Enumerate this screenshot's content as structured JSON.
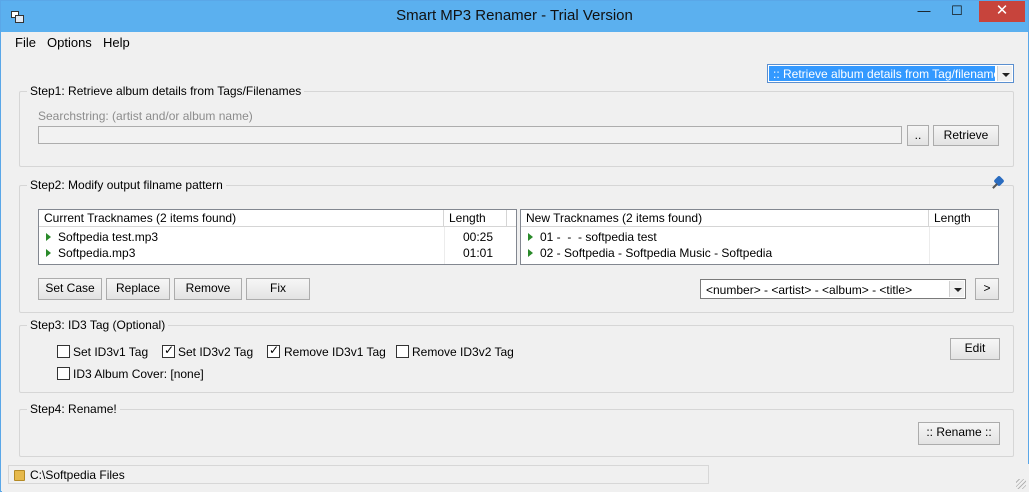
{
  "window": {
    "title": "Smart MP3 Renamer - Trial Version",
    "controls": {
      "minimize": "—",
      "maximize": "☐",
      "close": "✕"
    }
  },
  "menu": [
    "File",
    "Options",
    "Help"
  ],
  "mode_select": {
    "value": ":: Retrieve album details from Tag/filename ::"
  },
  "step1": {
    "title": "Step1: Retrieve album details from Tags/Filenames",
    "search_label": "Searchstring: (artist and/or album name)",
    "search_value": "",
    "browse_label": "..",
    "retrieve_label": "Retrieve"
  },
  "step2": {
    "title": "Step2: Modify output filname pattern",
    "current": {
      "col_name": "Current Tracknames (2 items found)",
      "col_length": "Length",
      "rows": [
        {
          "name": "Softpedia test.mp3",
          "length": "00:25"
        },
        {
          "name": "Softpedia.mp3",
          "length": "01:01"
        }
      ]
    },
    "new": {
      "col_name": "New Tracknames (2 items found)",
      "col_length": "Length",
      "rows": [
        {
          "name": "01 -  -  - softpedia test",
          "length": ""
        },
        {
          "name": "02 - Softpedia - Softpedia Music - Softpedia",
          "length": ""
        }
      ]
    },
    "buttons": {
      "set_case": "Set Case",
      "replace": "Replace",
      "remove": "Remove",
      "fix": "Fix"
    },
    "pattern": "<number> - <artist> - <album> - <title>",
    "apply_label": ">"
  },
  "step3": {
    "title": "Step3: ID3 Tag (Optional)",
    "options": [
      {
        "label": "Set ID3v1 Tag",
        "checked": false
      },
      {
        "label": "Set ID3v2 Tag",
        "checked": true
      },
      {
        "label": "Remove ID3v1 Tag",
        "checked": true
      },
      {
        "label": "Remove ID3v2 Tag",
        "checked": false
      }
    ],
    "album_cover": {
      "label": "ID3 Album Cover: [none]",
      "checked": false
    },
    "edit_label": "Edit"
  },
  "step4": {
    "title": "Step4: Rename!",
    "rename_label": ":: Rename ::"
  },
  "status": {
    "path": "C:\\Softpedia Files"
  }
}
